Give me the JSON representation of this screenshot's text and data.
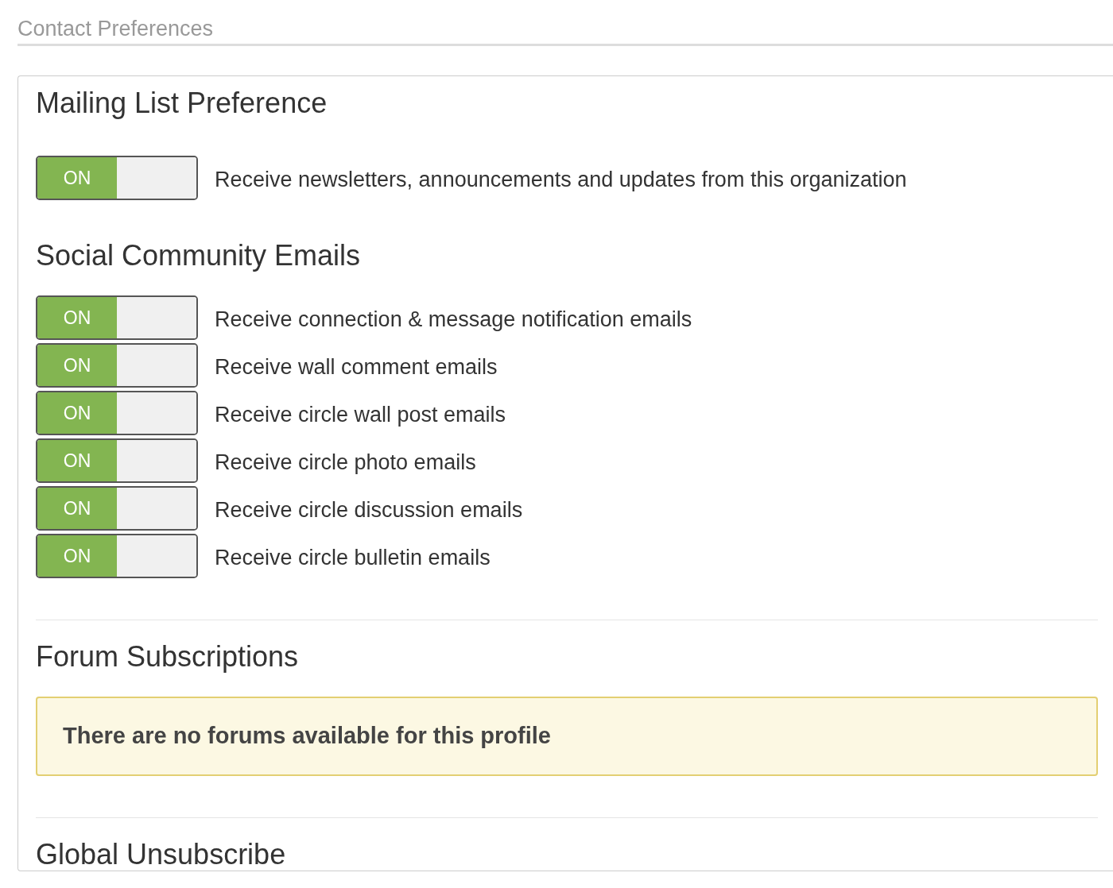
{
  "header": {
    "title": "Contact Preferences"
  },
  "sections": [
    {
      "kind": "toggles",
      "title": "Mailing List Preference",
      "divider_before": false,
      "toggles": [
        {
          "switch_text": "ON",
          "on": true,
          "label": "Receive newsletters, announcements and updates from this organization"
        }
      ]
    },
    {
      "kind": "toggles",
      "title": "Social Community Emails",
      "divider_before": false,
      "toggles": [
        {
          "switch_text": "ON",
          "on": true,
          "label": "Receive connection & message notification emails"
        },
        {
          "switch_text": "ON",
          "on": true,
          "label": "Receive wall comment emails"
        },
        {
          "switch_text": "ON",
          "on": true,
          "label": "Receive circle wall post emails"
        },
        {
          "switch_text": "ON",
          "on": true,
          "label": "Receive circle photo emails"
        },
        {
          "switch_text": "ON",
          "on": true,
          "label": "Receive circle discussion emails"
        },
        {
          "switch_text": "ON",
          "on": true,
          "label": "Receive circle bulletin emails"
        }
      ]
    },
    {
      "kind": "notice",
      "title": "Forum Subscriptions",
      "divider_before": true,
      "notice": "There are no forums available for this profile"
    },
    {
      "kind": "plain",
      "title": "Global Unsubscribe",
      "divider_before": true
    }
  ]
}
